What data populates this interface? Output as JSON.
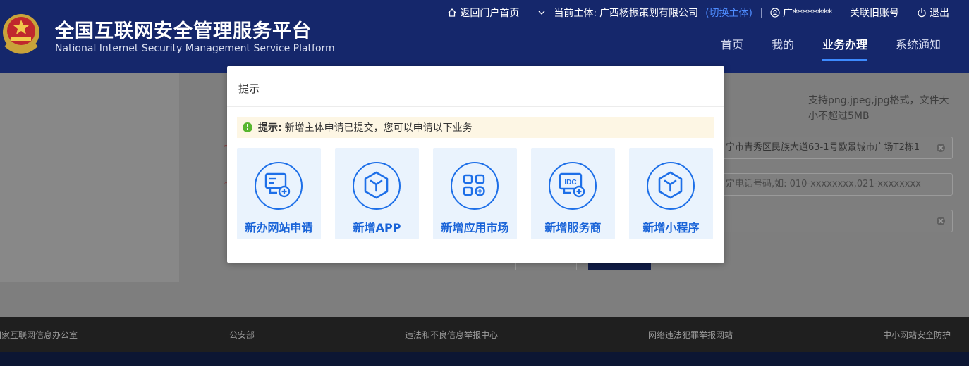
{
  "header": {
    "title": "全国互联网安全管理服务平台",
    "subtitle": "National Internet Security Management Service Platform",
    "topbar": {
      "home_link": "返回门户首页",
      "entity_label": "当前主体: ",
      "entity_name": "广西杨振策划有限公司",
      "switch_entity": "(切换主体)",
      "username": "广********",
      "link_old_account": "关联旧账号",
      "logout": "退出"
    },
    "nav": [
      {
        "label": "首页",
        "active": false
      },
      {
        "label": "我的",
        "active": false
      },
      {
        "label": "业务办理",
        "active": true
      },
      {
        "label": "系统通知",
        "active": false
      }
    ]
  },
  "background_form": {
    "file_hint": "支持png,jpeg,jpg格式，文件大小不超过5MB",
    "address_value": "宁市青秀区民族大道63-1号欧景城市广场T2栋1",
    "phone_placeholder": "定电话号码,如: 010-xxxxxxxx,021-xxxxxxxx",
    "required_mark": "*"
  },
  "modal": {
    "title": "提示",
    "alert_label": "提示:",
    "alert_text": "新增主体申请已提交，您可以申请以下业务",
    "options": [
      {
        "label": "新办网站申请",
        "icon": "website-add-icon"
      },
      {
        "label": "新增APP",
        "icon": "app-cube-icon"
      },
      {
        "label": "新增应用市场",
        "icon": "app-market-icon"
      },
      {
        "label": "新增服务商",
        "icon": "idc-provider-icon",
        "icon_text": "IDC"
      },
      {
        "label": "新增小程序",
        "icon": "mini-program-cube-icon"
      }
    ]
  },
  "footer": {
    "links": [
      "国家互联网信息办公室",
      "公安部",
      "违法和不良信息举报中心",
      "网络违法犯罪举报网站",
      "中小网站安全防护"
    ]
  },
  "colors": {
    "header_bg": "#15276b",
    "accent_blue": "#1d6fe8",
    "card_bg": "#eaf3fd",
    "alert_bg": "#fdf6e4",
    "success_green": "#58b62f"
  }
}
